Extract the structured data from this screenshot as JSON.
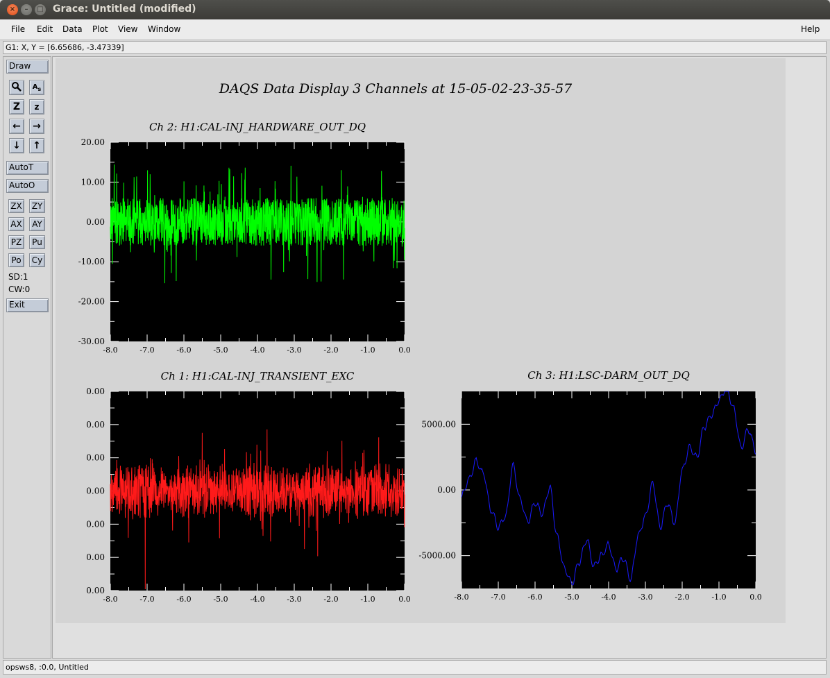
{
  "window": {
    "title": "Grace: Untitled (modified)"
  },
  "menubar": {
    "items": [
      "File",
      "Edit",
      "Data",
      "Plot",
      "View",
      "Window"
    ],
    "help": "Help"
  },
  "locator": "G1: X, Y = [6.65686, -3.47339]",
  "toolbar": {
    "draw": "Draw",
    "autot": "AutoT",
    "autoo": "AutoO",
    "small_buttons": [
      "ZX",
      "ZY",
      "AX",
      "AY",
      "PZ",
      "Pu",
      "Po",
      "Cy"
    ],
    "sd": "SD:1",
    "cw": "CW:0",
    "exit": "Exit",
    "icons": [
      "zoom-icon",
      "text-edit-icon",
      "zoom-in-icon",
      "zoom-out-icon",
      "left-arrow-icon",
      "right-arrow-icon",
      "down-arrow-icon",
      "up-arrow-icon"
    ]
  },
  "page_title": "DAQS Data Display 3 Channels at 15-05-02-23-35-57",
  "footer": "opsws8, :0.0, Untitled",
  "chart_data": [
    {
      "type": "line",
      "title": "Ch 2:  H1:CAL-INJ_HARDWARE_OUT_DQ",
      "color": "#00ff00",
      "xlim": [
        -8.0,
        0.0
      ],
      "ylim": [
        -30.0,
        20.0
      ],
      "x_ticks": [
        "-8.0",
        "-7.0",
        "-6.0",
        "-5.0",
        "-4.0",
        "-3.0",
        "-2.0",
        "-1.0",
        "0.0"
      ],
      "y_ticks": [
        "20.00",
        "10.00",
        "0.00",
        "-10.00",
        "-20.00",
        "-30.00"
      ],
      "signal": {
        "mean": 0.0,
        "min": -22.0,
        "max": 18.0
      }
    },
    {
      "type": "line",
      "title": "Ch 1:  H1:CAL-INJ_TRANSIENT_EXC",
      "color": "#ff1a1a",
      "xlim": [
        -8.0,
        0.0
      ],
      "x_ticks": [
        "-8.0",
        "-7.0",
        "-6.0",
        "-5.0",
        "-4.0",
        "-3.0",
        "-2.0",
        "-1.0",
        "0.0"
      ],
      "y_ticks": [
        "0.00",
        "0.00",
        "0.00",
        "0.00",
        "0.00",
        "0.00",
        "0.00"
      ]
    },
    {
      "type": "line",
      "title": "Ch 3:  H1:LSC-DARM_OUT_DQ",
      "color": "#1a1aff",
      "xlim": [
        -8.0,
        0.0
      ],
      "ylim": [
        -7500,
        7500
      ],
      "x_ticks": [
        "-8.0",
        "-7.0",
        "-6.0",
        "-5.0",
        "-4.0",
        "-3.0",
        "-2.0",
        "-1.0",
        "0.0"
      ],
      "y_ticks": [
        "5000.00",
        "0.00",
        "-5000.00"
      ],
      "y_tick_values": [
        5000,
        0,
        -5000
      ],
      "x": [
        -8.0,
        -7.8,
        -7.6,
        -7.4,
        -7.2,
        -7.0,
        -6.8,
        -6.6,
        -6.4,
        -6.2,
        -6.0,
        -5.8,
        -5.6,
        -5.4,
        -5.2,
        -5.0,
        -4.8,
        -4.6,
        -4.4,
        -4.2,
        -4.0,
        -3.8,
        -3.6,
        -3.4,
        -3.2,
        -3.0,
        -2.8,
        -2.6,
        -2.4,
        -2.2,
        -2.0,
        -1.8,
        -1.6,
        -1.4,
        -1.2,
        -1.0,
        -0.8,
        -0.6,
        -0.4,
        -0.2,
        0.0
      ],
      "y": [
        -500,
        800,
        2200,
        1200,
        -1500,
        -2800,
        -2000,
        1800,
        -800,
        -2400,
        -1000,
        -1800,
        200,
        -3500,
        -6000,
        -7100,
        -5500,
        -3800,
        -5800,
        -5000,
        -4200,
        -6000,
        -5200,
        -6800,
        -3500,
        -2000,
        500,
        -2800,
        -1000,
        -2500,
        1500,
        3200,
        2500,
        4800,
        5700,
        6800,
        7800,
        6200,
        3200,
        4600,
        3000
      ]
    }
  ]
}
